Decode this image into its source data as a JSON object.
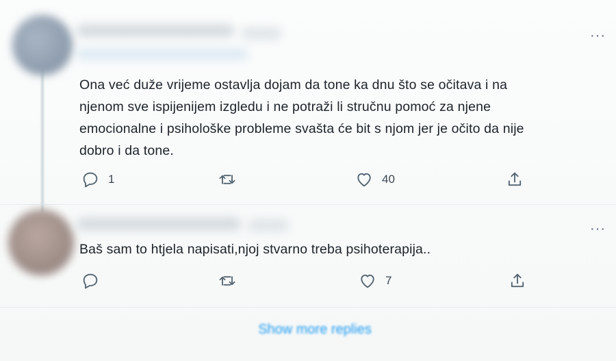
{
  "colors": {
    "accent": "#1d9bf0",
    "icon": "#536471",
    "text": "#0f1419",
    "background": "#f7f9f9"
  },
  "replies": [
    {
      "text": "Ona već duže vrijeme ostavlja dojam da tone ka dnu što se očitava i na\nnjenom sve ispijenijem izgledu i ne potraži li stručnu pomoć za njene\nemocionalne i psihološke probleme svašta će bit s njom jer je očito da nije\ndobro i da tone.",
      "more_icon": "···",
      "reply_count": "1",
      "retweet_count": "",
      "like_count": "40",
      "icons": [
        "reply-icon",
        "retweet-icon",
        "like-icon",
        "share-icon"
      ]
    },
    {
      "text": "Baš sam to htjela napisati,njoj stvarno treba psihoterapija..",
      "more_icon": "···",
      "reply_count": "",
      "retweet_count": "",
      "like_count": "7",
      "icons": [
        "reply-icon",
        "retweet-icon",
        "like-icon",
        "share-icon"
      ]
    }
  ],
  "show_more_replies": "Show more replies"
}
